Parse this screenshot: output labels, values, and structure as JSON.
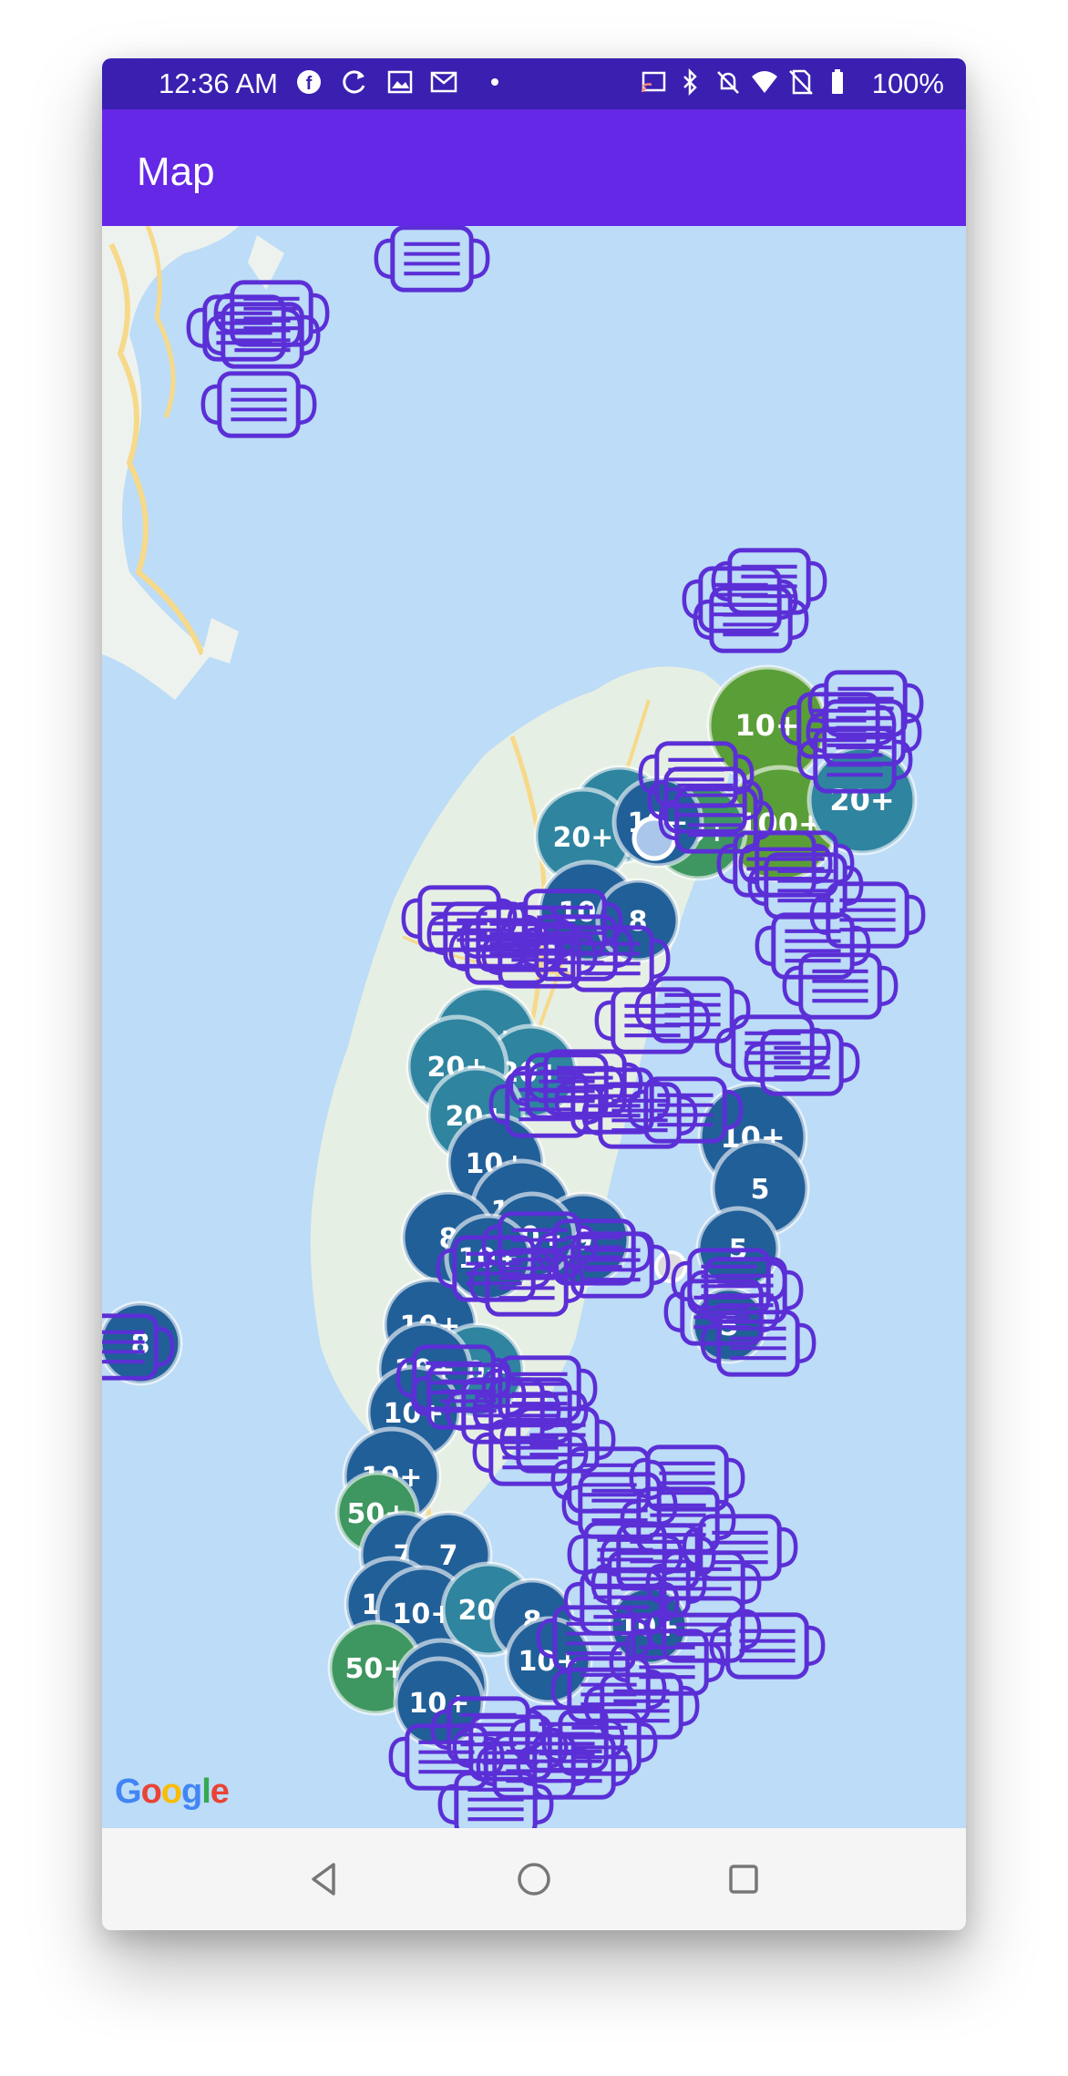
{
  "status_bar": {
    "time": "12:36 AM",
    "battery": "100%",
    "icons": [
      "facebook-icon",
      "sync-icon",
      "image-icon",
      "gmail-icon",
      "dot-icon",
      "cast-icon",
      "bluetooth-icon",
      "bell-off-icon",
      "wifi-icon",
      "no-sim-icon",
      "battery-icon"
    ]
  },
  "app_bar": {
    "title": "Map"
  },
  "map": {
    "attribution": "Google",
    "clusters": [
      {
        "label": "10+",
        "color": "#5a9e38"
      },
      {
        "label": "100+",
        "color": "#5a9e38"
      },
      {
        "label": "50+",
        "color": "#3e9660"
      },
      {
        "label": "20+",
        "color": "#2f84a0"
      },
      {
        "label": "20+",
        "color": "#2f84a0"
      },
      {
        "label": "10+",
        "color": "#215f98"
      },
      {
        "label": "10+",
        "color": "#215f98"
      },
      {
        "label": "8",
        "color": "#215f98"
      },
      {
        "label": "20+",
        "color": "#2f84a0"
      },
      {
        "label": "10+",
        "color": "#215f98"
      },
      {
        "label": "20+",
        "color": "#2f84a0"
      },
      {
        "label": "20+",
        "color": "#2f84a0"
      },
      {
        "label": "20+",
        "color": "#2f84a0"
      },
      {
        "label": "20+",
        "color": "#2f84a0"
      },
      {
        "label": "10+",
        "color": "#215f98"
      },
      {
        "label": "10+",
        "color": "#215f98"
      },
      {
        "label": "9",
        "color": "#215f98"
      },
      {
        "label": "10+",
        "color": "#215f98"
      },
      {
        "label": "8",
        "color": "#215f98"
      },
      {
        "label": "10+",
        "color": "#215f98"
      },
      {
        "label": "5",
        "color": "#215f98"
      },
      {
        "label": "5",
        "color": "#215f98"
      },
      {
        "label": "8",
        "color": "#215f98"
      },
      {
        "label": "10+",
        "color": "#215f98"
      },
      {
        "label": "20+",
        "color": "#2f84a0"
      },
      {
        "label": "10+",
        "color": "#215f98"
      },
      {
        "label": "10+",
        "color": "#215f98"
      },
      {
        "label": "10+",
        "color": "#215f98"
      },
      {
        "label": "50+",
        "color": "#3e9660"
      },
      {
        "label": "7",
        "color": "#215f98"
      },
      {
        "label": "7",
        "color": "#215f98"
      },
      {
        "label": "10+",
        "color": "#215f98"
      },
      {
        "label": "10+",
        "color": "#215f98"
      },
      {
        "label": "20+",
        "color": "#2f84a0"
      },
      {
        "label": "8",
        "color": "#215f98"
      },
      {
        "label": "50+",
        "color": "#3e9660"
      },
      {
        "label": "10+",
        "color": "#215f98"
      },
      {
        "label": "10+",
        "color": "#215f98"
      },
      {
        "label": "5",
        "color": "#215f98"
      },
      {
        "label": "10+",
        "color": "#215f98"
      },
      {
        "label": "10+",
        "color": "#215f98"
      }
    ],
    "marker_icon": "face-mask-icon",
    "marker_color": "#5b2fd6"
  },
  "nav_bar": {
    "back": "back-icon",
    "home": "home-icon",
    "recents": "recents-icon"
  }
}
